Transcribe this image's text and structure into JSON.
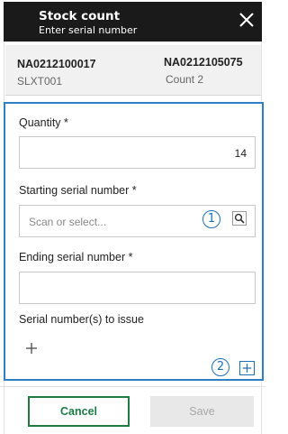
{
  "header": {
    "title": "Stock count",
    "subtitle": "Enter serial number",
    "close_icon": "close-icon"
  },
  "item": {
    "left_id": "NA0212100017",
    "left_sub": "SLXT001",
    "right_id": "NA0212105075",
    "right_sub": "Count 2"
  },
  "form": {
    "quantity_label": "Quantity *",
    "quantity_value": "14",
    "start_label": "Starting serial number *",
    "start_placeholder": "Scan or select...",
    "end_label": "Ending serial number *",
    "end_value": "",
    "issue_label": "Serial number(s) to issue",
    "callout_1": "1",
    "callout_2": "2"
  },
  "footer": {
    "cancel_label": "Cancel",
    "save_label": "Save"
  },
  "colors": {
    "header_bg": "#1a1a1a",
    "accent_blue": "#2e7fc4",
    "brand_green": "#1e7a45",
    "disabled_bg": "#e8e8e8"
  }
}
